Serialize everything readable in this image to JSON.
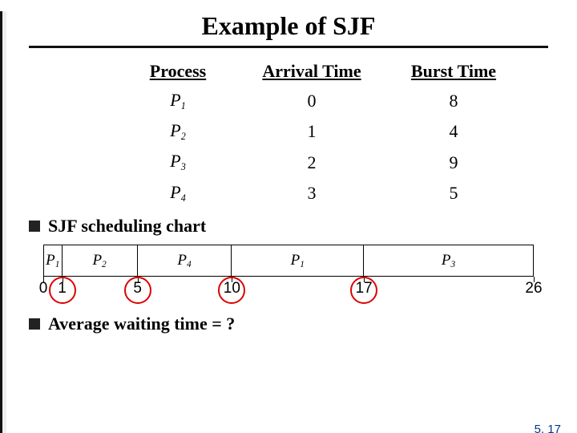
{
  "heading": {
    "title": "Example of SJF"
  },
  "table": {
    "cols": [
      "Process",
      "Arrival Time",
      "Burst Time"
    ],
    "rows": [
      {
        "process_base": "P",
        "process_sub": "1",
        "arrival": "0",
        "burst": "8"
      },
      {
        "process_base": "P",
        "process_sub": "2",
        "arrival": "1",
        "burst": "4"
      },
      {
        "process_base": "P",
        "process_sub": "3",
        "arrival": "2",
        "burst": "9"
      },
      {
        "process_base": "P",
        "process_sub": "4",
        "arrival": "3",
        "burst": "5"
      }
    ]
  },
  "bullets": {
    "scheduling_chart": "SJF scheduling chart",
    "avg_wait": "Average waiting time = ?"
  },
  "chart_data": {
    "type": "bar",
    "title": "Gantt chart",
    "x": [
      0,
      1,
      5,
      10,
      17,
      26
    ],
    "segments": [
      {
        "label_base": "P",
        "label_sub": "1",
        "start": 0,
        "end": 1
      },
      {
        "label_base": "P",
        "label_sub": "2",
        "start": 1,
        "end": 5
      },
      {
        "label_base": "P",
        "label_sub": "4",
        "start": 5,
        "end": 10
      },
      {
        "label_base": "P",
        "label_sub": "1",
        "start": 10,
        "end": 17
      },
      {
        "label_base": "P",
        "label_sub": "3",
        "start": 17,
        "end": 26
      }
    ],
    "xlabel": "",
    "ylabel": "",
    "xlim": [
      0,
      26
    ],
    "highlight_ticks": [
      1,
      5,
      10,
      17
    ]
  },
  "footer": {
    "page": "5. 17"
  },
  "colors": {
    "highlight": "#d00",
    "page_link": "#003a8a"
  }
}
